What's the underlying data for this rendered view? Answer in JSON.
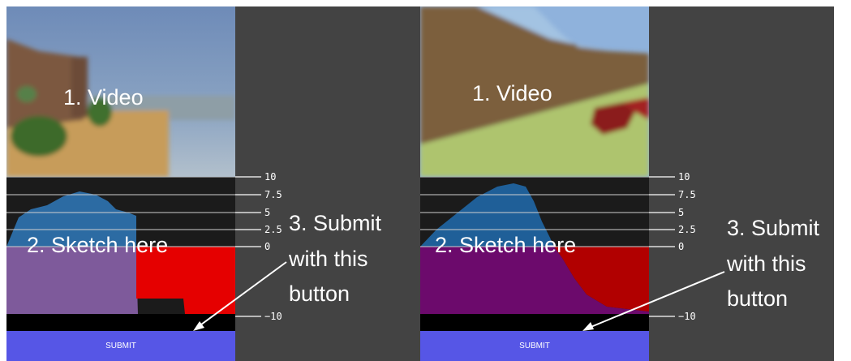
{
  "panels": [
    {
      "scene": "outdoor",
      "annotations": {
        "video": "1. Video",
        "sketch": "2. Sketch here",
        "submit_line1": "3. Submit",
        "submit_line2": "with this",
        "submit_line3": "button"
      },
      "axis_ticks": [
        "10",
        "7.5",
        "5",
        "2.5",
        "0",
        "−10"
      ],
      "submit_label": "SUBMIT",
      "colors": {
        "upper_fill": "#2c6ba3",
        "lower_left": "#7e5a9b",
        "lower_right": "#e50000"
      }
    },
    {
      "scene": "room",
      "annotations": {
        "video": "1. Video",
        "sketch": "2. Sketch here",
        "submit_line1": "3. Submit",
        "submit_line2": "with this",
        "submit_line3": "button"
      },
      "axis_ticks": [
        "10",
        "7.5",
        "5",
        "2.5",
        "0",
        "−10"
      ],
      "submit_label": "SUBMIT",
      "colors": {
        "upper_fill": "#1f5f98",
        "lower_left": "#6c0a6c",
        "lower_right": "#b10000"
      }
    }
  ]
}
